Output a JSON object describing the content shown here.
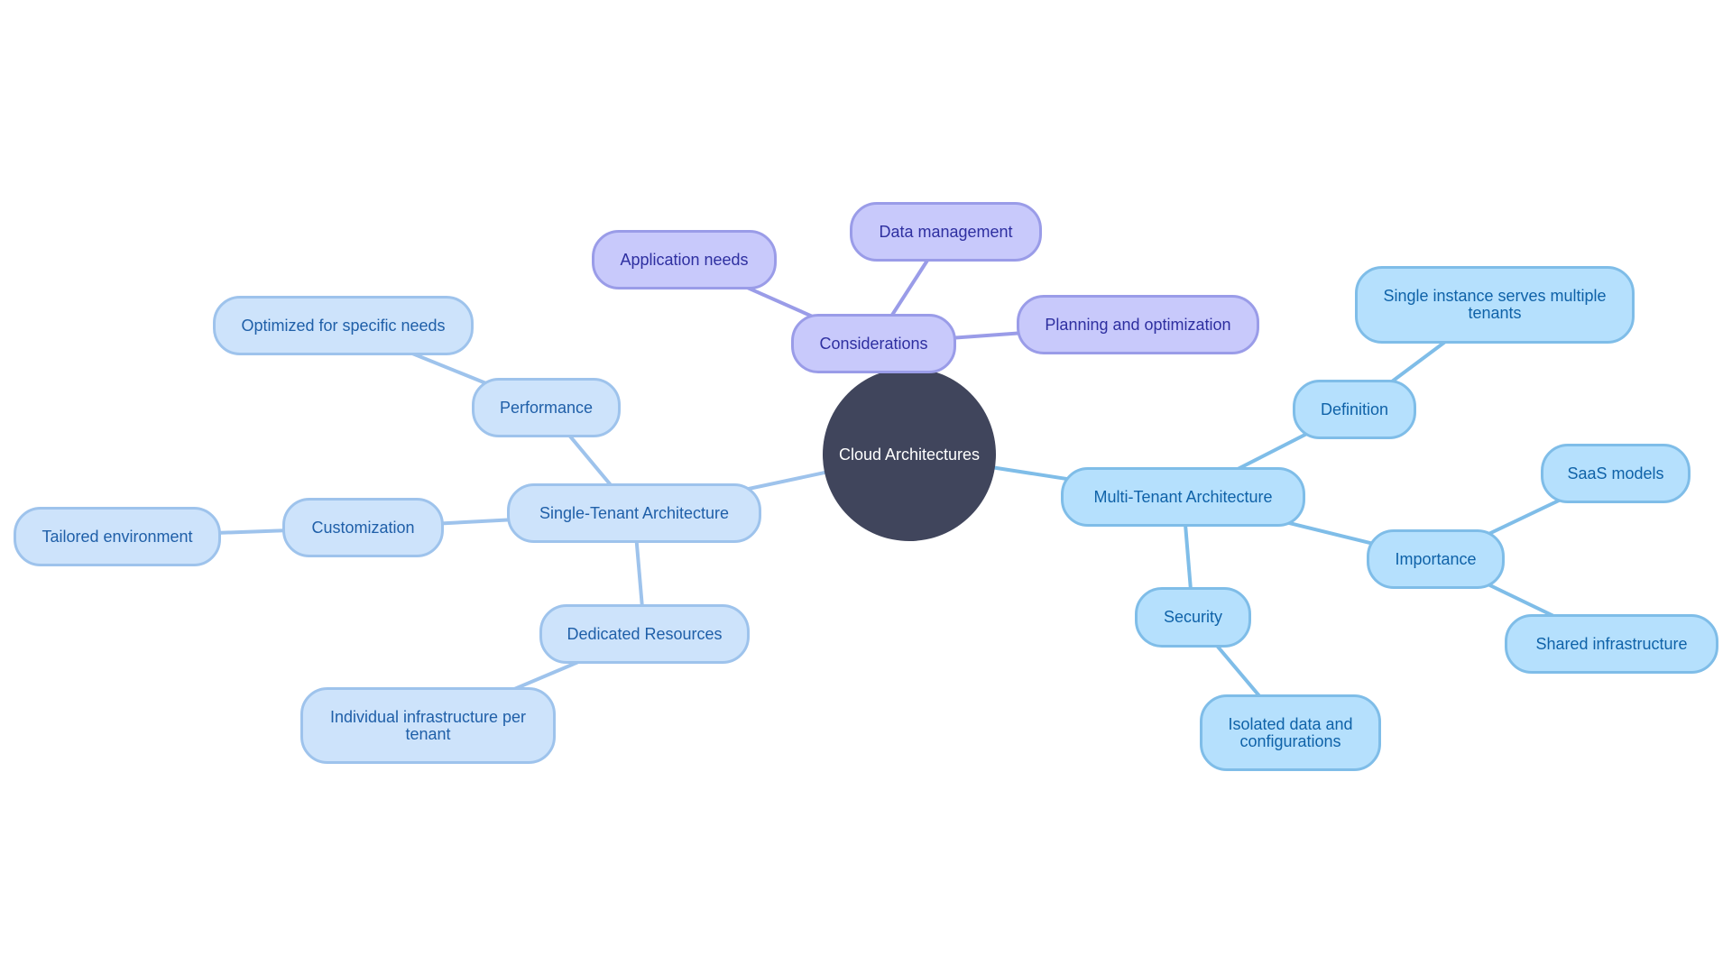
{
  "diagram": {
    "type": "mindmap",
    "root": {
      "id": "root",
      "label": "Cloud Architectures",
      "color": "#40455c"
    },
    "branch_colors": {
      "single": {
        "fill": "#cde3fb",
        "stroke": "#9ec3ec",
        "text": "#1f5fa8"
      },
      "multi": {
        "fill": "#b5e0fd",
        "stroke": "#7fbde8",
        "text": "#0f62a8"
      },
      "cons": {
        "fill": "#c8c9fb",
        "stroke": "#9a9ce8",
        "text": "#2e2fa0"
      }
    },
    "nodes": [
      {
        "id": "considerations",
        "label": "Considerations",
        "branch": "cons",
        "parent": "root"
      },
      {
        "id": "app_needs",
        "label": "Application needs",
        "branch": "cons",
        "parent": "considerations"
      },
      {
        "id": "data_mgmt",
        "label": "Data management",
        "branch": "cons",
        "parent": "considerations"
      },
      {
        "id": "planning",
        "label": "Planning and optimization",
        "branch": "cons",
        "parent": "considerations"
      },
      {
        "id": "single_tenant",
        "label": "Single-Tenant Architecture",
        "branch": "single",
        "parent": "root"
      },
      {
        "id": "performance",
        "label": "Performance",
        "branch": "single",
        "parent": "single_tenant"
      },
      {
        "id": "optimized",
        "label": "Optimized for specific needs",
        "branch": "single",
        "parent": "performance"
      },
      {
        "id": "customization",
        "label": "Customization",
        "branch": "single",
        "parent": "single_tenant"
      },
      {
        "id": "tailored",
        "label": "Tailored environment",
        "branch": "single",
        "parent": "customization"
      },
      {
        "id": "dedicated",
        "label": "Dedicated Resources",
        "branch": "single",
        "parent": "single_tenant"
      },
      {
        "id": "individual",
        "label": "Individual infrastructure per tenant",
        "branch": "single",
        "parent": "dedicated"
      },
      {
        "id": "multi_tenant",
        "label": "Multi-Tenant Architecture",
        "branch": "multi",
        "parent": "root"
      },
      {
        "id": "definition",
        "label": "Definition",
        "branch": "multi",
        "parent": "multi_tenant"
      },
      {
        "id": "single_instance",
        "label": "Single instance serves multiple tenants",
        "branch": "multi",
        "parent": "definition"
      },
      {
        "id": "importance",
        "label": "Importance",
        "branch": "multi",
        "parent": "multi_tenant"
      },
      {
        "id": "saas",
        "label": "SaaS models",
        "branch": "multi",
        "parent": "importance"
      },
      {
        "id": "shared",
        "label": "Shared infrastructure",
        "branch": "multi",
        "parent": "importance"
      },
      {
        "id": "security",
        "label": "Security",
        "branch": "multi",
        "parent": "multi_tenant"
      },
      {
        "id": "isolated",
        "label": "Isolated data and configurations",
        "branch": "multi",
        "parent": "security"
      }
    ]
  }
}
